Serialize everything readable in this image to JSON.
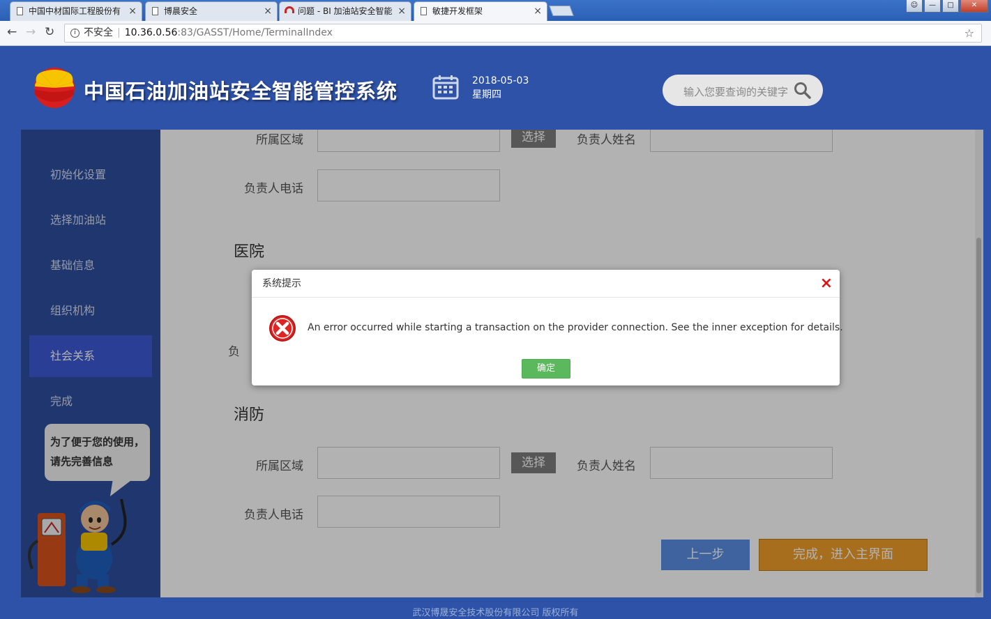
{
  "browser": {
    "tabs": [
      {
        "title": "中国中材国际工程股份有"
      },
      {
        "title": "博晨安全"
      },
      {
        "title": "问题 - BI 加油站安全智能"
      },
      {
        "title": "敏捷开发框架"
      }
    ],
    "security_label": "不安全",
    "url_host": "10.36.0.56",
    "url_rest": ":83/GASST/Home/TerminalIndex"
  },
  "header": {
    "title": "中国石油加油站安全智能管控系统",
    "date": "2018-05-03",
    "weekday": "星期四",
    "search_placeholder": "输入您要查询的关键字"
  },
  "sidebar": {
    "items": [
      {
        "label": "初始化设置"
      },
      {
        "label": "选择加油站"
      },
      {
        "label": "基础信息"
      },
      {
        "label": "组织机构"
      },
      {
        "label": "社会关系"
      },
      {
        "label": "完成"
      }
    ],
    "active_index": 4,
    "tip": "为了便于您的使用，请先完善信息"
  },
  "form": {
    "region_label": "所属区域",
    "select_label": "选择",
    "manager_name_label": "负责人姓名",
    "manager_phone_label": "负责人电话",
    "section_hospital": "医院",
    "section_fire": "消防",
    "partial_label": "负",
    "prev_button": "上一步",
    "finish_button": "完成，进入主界面"
  },
  "dialog": {
    "title": "系统提示",
    "close": "×",
    "message": "An error occurred while starting a transaction on the provider connection. See the inner exception for details.",
    "ok": "确定"
  },
  "footer": {
    "copyright": "武汉博晟安全技术股份有限公司 版权所有"
  },
  "colors": {
    "header_bg": "#2e52a8",
    "active_nav": "#3d5ad6",
    "finish_btn": "#f0a02a",
    "ok_btn": "#5cb85c",
    "error": "#e01010"
  }
}
